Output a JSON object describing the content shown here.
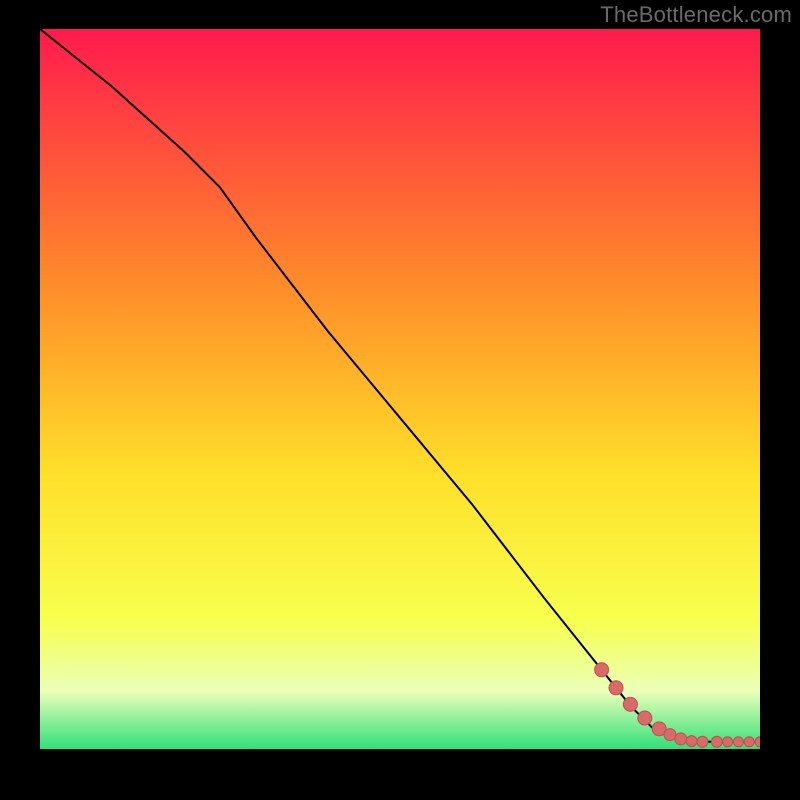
{
  "watermark": "TheBottleneck.com",
  "colors": {
    "page_bg": "#000000",
    "watermark_text": "#6a6a6a",
    "curve_stroke": "#000000",
    "marker_fill": "#d86a6a",
    "marker_stroke": "#c24e4e",
    "gradient_top": "#ff1a4d",
    "gradient_upper_mid": "#ff8a2a",
    "gradient_mid": "#ffe02a",
    "gradient_lower_mid": "#f7ff4d",
    "gradient_band_pale": "#eaffb8",
    "gradient_bottom": "#2fe07a"
  },
  "chart_data": {
    "type": "line",
    "title": "",
    "xlabel": "",
    "ylabel": "",
    "xlim": [
      0,
      100
    ],
    "ylim": [
      0,
      100
    ],
    "gradient_stops": [
      {
        "offset": 0.0,
        "color": "#ff1a4d"
      },
      {
        "offset": 0.35,
        "color": "#ff8a2a"
      },
      {
        "offset": 0.62,
        "color": "#ffe02a"
      },
      {
        "offset": 0.82,
        "color": "#f7ff4d"
      },
      {
        "offset": 0.92,
        "color": "#eaffb8"
      },
      {
        "offset": 1.0,
        "color": "#2fe07a"
      }
    ],
    "series": [
      {
        "name": "curve",
        "x": [
          0,
          10,
          20,
          25,
          30,
          40,
          50,
          60,
          70,
          78,
          82,
          85,
          88,
          90,
          92,
          95,
          98,
          100
        ],
        "y": [
          100,
          92,
          83,
          78,
          71,
          58,
          46,
          34,
          21,
          11,
          6,
          3,
          1.5,
          1,
          1,
          1,
          1,
          1
        ]
      }
    ],
    "markers": {
      "name": "highlighted-points",
      "x": [
        78,
        80,
        82,
        84,
        86,
        87.5,
        89,
        90.5,
        92,
        94,
        95.5,
        97,
        98.5,
        100
      ],
      "y": [
        11,
        8.5,
        6.2,
        4.3,
        2.8,
        2.0,
        1.4,
        1.1,
        1.0,
        1.0,
        1.0,
        1.0,
        1.0,
        1.0
      ],
      "sizes": [
        7,
        7,
        7,
        7,
        7,
        6,
        6,
        5.5,
        5.5,
        5.5,
        5,
        5,
        5,
        5
      ]
    }
  }
}
